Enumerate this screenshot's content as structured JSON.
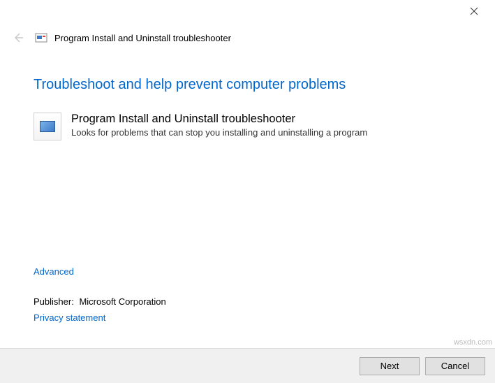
{
  "window": {
    "title": "Program Install and Uninstall troubleshooter"
  },
  "page": {
    "heading": "Troubleshoot and help prevent computer problems"
  },
  "item": {
    "title": "Program Install and Uninstall troubleshooter",
    "description": "Looks for problems that can stop you installing and uninstalling a program"
  },
  "links": {
    "advanced": "Advanced",
    "privacy": "Privacy statement"
  },
  "publisher": {
    "label": "Publisher:",
    "name": "Microsoft Corporation"
  },
  "buttons": {
    "next": "Next",
    "cancel": "Cancel"
  },
  "watermark": "wsxdn.com"
}
